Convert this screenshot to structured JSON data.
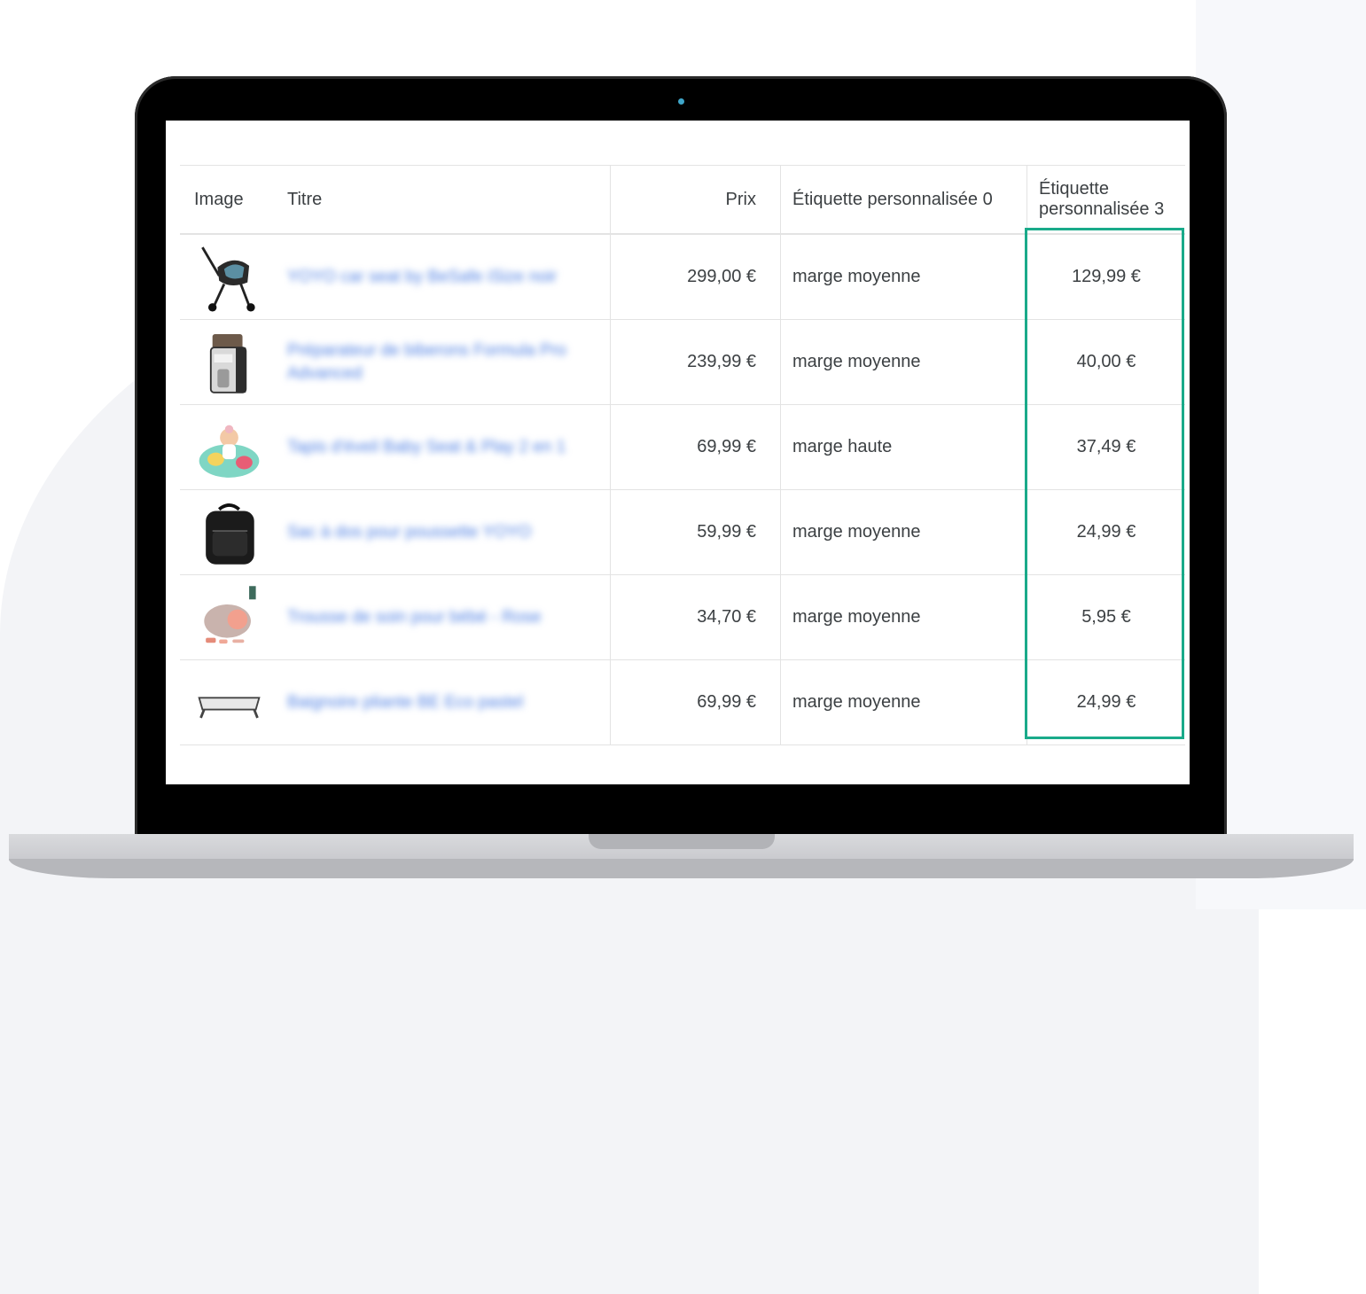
{
  "table": {
    "headers": {
      "image": "Image",
      "title": "Titre",
      "price": "Prix",
      "tag0": "Étiquette personnalisée 0",
      "tag3": "Étiquette personnalisée 3"
    },
    "rows": [
      {
        "title": "YOYO car seat by BeSafe iSize noir",
        "price": "299,00 €",
        "tag0": "marge moyenne",
        "tag3": "129,99 €",
        "icon": "stroller-car-seat-thumbnail"
      },
      {
        "title": "Préparateur de biberons Formula Pro Advanced",
        "price": "239,99 €",
        "tag0": "marge moyenne",
        "tag3": "40,00 €",
        "icon": "formula-maker-thumbnail"
      },
      {
        "title": "Tapis d'éveil Baby Seat & Play 2 en 1",
        "price": "69,99 €",
        "tag0": "marge haute",
        "tag3": "37,49 €",
        "icon": "baby-seat-thumbnail"
      },
      {
        "title": "Sac à dos pour poussette YOYO",
        "price": "59,99 €",
        "tag0": "marge moyenne",
        "tag3": "24,99 €",
        "icon": "backpack-thumbnail"
      },
      {
        "title": "Trousse de soin pour bébé - Rose",
        "price": "34,70 €",
        "tag0": "marge moyenne",
        "tag3": "5,95 €",
        "icon": "care-kit-thumbnail"
      },
      {
        "title": "Baignoire pliante BE Eco pastel",
        "price": "69,99 €",
        "tag0": "marge moyenne",
        "tag3": "24,99 €",
        "icon": "bathtub-thumbnail"
      }
    ]
  },
  "colors": {
    "highlight": "#1aaa8a",
    "link": "#4d7fe3",
    "bezel": "#000000"
  }
}
